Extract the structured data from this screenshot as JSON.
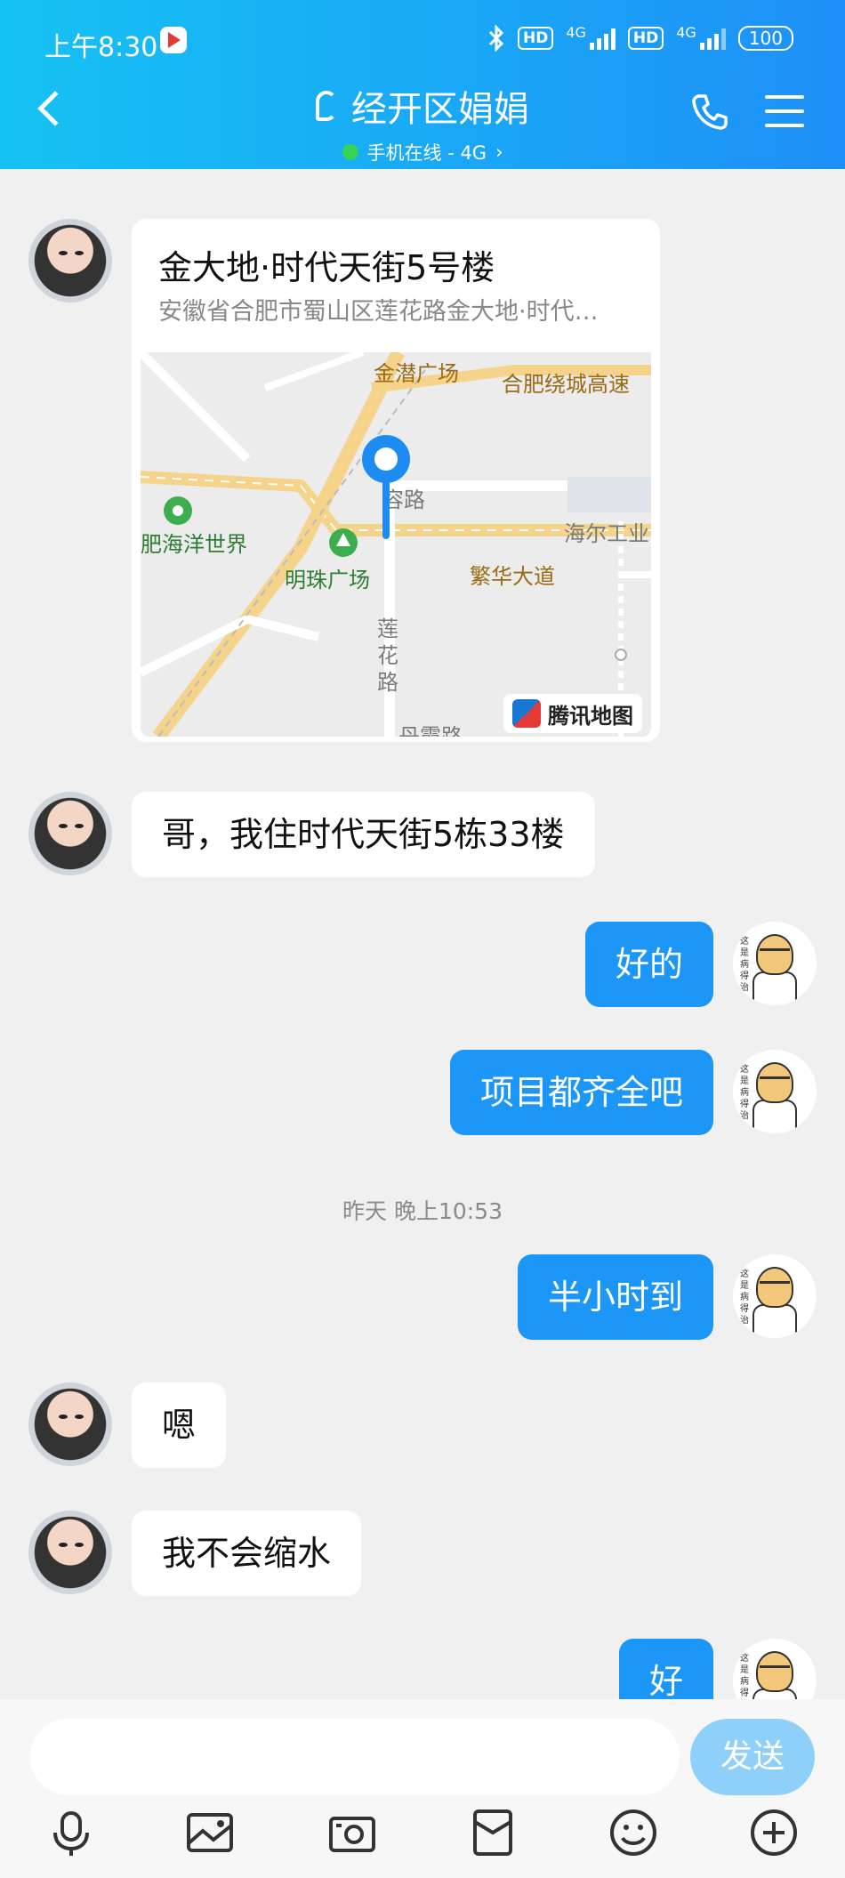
{
  "status_bar": {
    "time": "上午8:30",
    "network1": "4G",
    "network2": "4G",
    "hd": "HD",
    "battery": "100"
  },
  "header": {
    "title": "经开区娟娟",
    "subtitle": "手机在线 - 4G",
    "subtitle_arrow": "›",
    "online_color": "#35d35a"
  },
  "messages": {
    "location": {
      "title": "金大地·时代天街5号楼",
      "address": "安徽省合肥市蜀山区莲花路金大地·时代…",
      "map_labels": {
        "l1": "金潜广场",
        "l2": "合肥绕城高速",
        "l3": "肥海洋世界",
        "l4": "明珠广场",
        "l5": "繁华大道",
        "l6": "海尔工业",
        "l7": "莲花路",
        "l8": "丹霞路",
        "l9": "容路"
      },
      "map_brand": "腾讯地图"
    },
    "m1": "哥，我住时代天街5栋33楼",
    "m2": "好的",
    "m3": "项目都齐全吧",
    "timestamp": "昨天 晚上10:53",
    "m4": "半小时到",
    "m5": "嗯",
    "m6": "我不会缩水",
    "m7": "好"
  },
  "my_avatar_text": "这是病得治",
  "input_bar": {
    "placeholder": "",
    "send_label": "发送"
  },
  "toolbar_icons": [
    "microphone-icon",
    "image-icon",
    "camera-icon",
    "red-packet-icon",
    "emoji-icon",
    "plus-icon"
  ],
  "colors": {
    "header_start": "#16c2f3",
    "header_end": "#1e8ff7",
    "outgoing_bubble": "#1c97f7",
    "send_button": "#8fd0fa"
  }
}
